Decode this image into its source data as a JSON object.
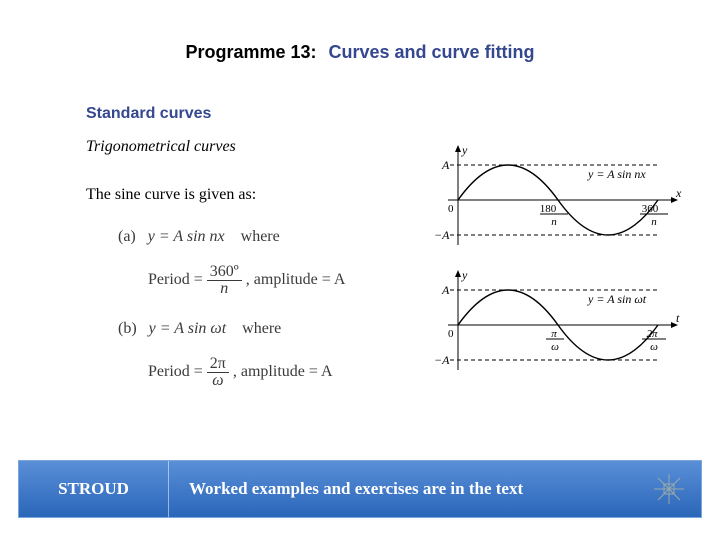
{
  "header": {
    "programme": "Programme 13:",
    "title": "Curves and curve fitting"
  },
  "section": "Standard curves",
  "subsection": "Trigonometrical curves",
  "intro": "The sine curve is given as:",
  "math": {
    "a_label": "(a)",
    "a_eq": "y = A sin nx",
    "where": "where",
    "period_lhs": "Period =",
    "a_period_num": "360º",
    "a_period_den": "n",
    "amp_text": ", amplitude = A",
    "b_label": "(b)",
    "b_eq": "y = A sin ωt",
    "b_period_num": "2π",
    "b_period_den": "ω"
  },
  "graph1": {
    "y_axis": "y",
    "x_axis": "x",
    "A": "A",
    "negA": "−A",
    "origin": "0",
    "tick1_num": "180",
    "tick1_den": "n",
    "tick2_num": "360",
    "tick2_den": "n",
    "eq": "y = A sin nx"
  },
  "graph2": {
    "y_axis": "y",
    "x_axis": "t",
    "A": "A",
    "negA": "−A",
    "origin": "0",
    "tick1_num": "π",
    "tick1_den": "ω",
    "tick2_num": "2π",
    "tick2_den": "ω",
    "eq": "y = A sin ωt"
  },
  "footer": {
    "brand": "STROUD",
    "text": "Worked examples and exercises are in the text"
  }
}
